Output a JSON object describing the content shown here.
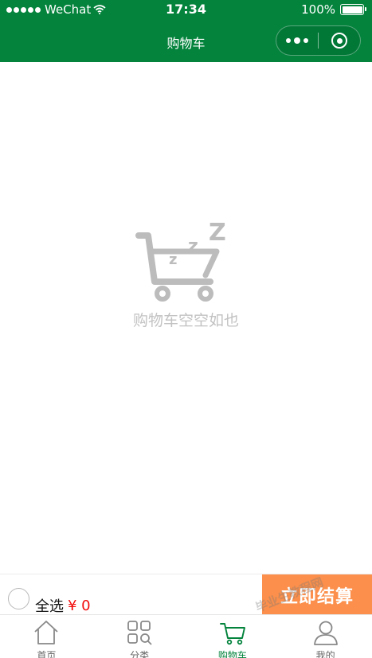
{
  "status_bar": {
    "carrier": "WeChat",
    "time": "17:34",
    "battery": "100%"
  },
  "nav": {
    "title": "购物车"
  },
  "empty_state": {
    "message": "购物车空空如也"
  },
  "checkout": {
    "select_all_label": "全选",
    "total": "¥ 0",
    "checkout_label": "立即结算"
  },
  "tabs": [
    {
      "label": "首页",
      "icon": "home-icon",
      "active": false
    },
    {
      "label": "分类",
      "icon": "category-icon",
      "active": false
    },
    {
      "label": "购物车",
      "icon": "cart-icon",
      "active": true
    },
    {
      "label": "我的",
      "icon": "profile-icon",
      "active": false
    }
  ],
  "watermark": "毕业生教程网",
  "colors": {
    "brand_green": "#03833c",
    "checkout_orange": "#fb8f4b",
    "price_red": "#f20c0c",
    "empty_gray": "#c2c2c2"
  }
}
